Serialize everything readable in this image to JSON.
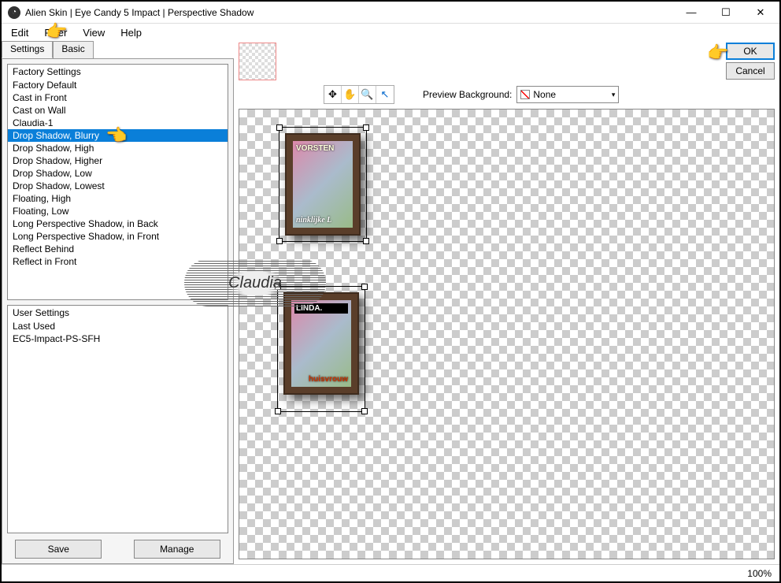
{
  "window": {
    "title": "Alien Skin | Eye Candy 5 Impact | Perspective Shadow"
  },
  "menu": {
    "items": [
      "Edit",
      "Filter",
      "View",
      "Help"
    ]
  },
  "tabs": {
    "settings": "Settings",
    "basic": "Basic"
  },
  "factory": {
    "header": "Factory Settings",
    "items": [
      "Factory Default",
      "Cast in Front",
      "Cast on Wall",
      "Claudia-1",
      "Drop Shadow, Blurry",
      "Drop Shadow, High",
      "Drop Shadow, Higher",
      "Drop Shadow, Low",
      "Drop Shadow, Lowest",
      "Floating, High",
      "Floating, Low",
      "Long Perspective Shadow, in Back",
      "Long Perspective Shadow, in Front",
      "Reflect Behind",
      "Reflect in Front"
    ],
    "selected_index": 4
  },
  "user": {
    "header": "User Settings",
    "items": [
      "Last Used",
      "EC5-Impact-PS-SFH"
    ]
  },
  "buttons": {
    "save": "Save",
    "manage": "Manage",
    "ok": "OK",
    "cancel": "Cancel"
  },
  "preview_bg": {
    "label": "Preview Background:",
    "value": "None"
  },
  "status": {
    "zoom": "100%"
  },
  "watermark": "Claudia",
  "mag1": {
    "top": "VORSTEN",
    "bottom": "ninklijke L"
  },
  "mag2": {
    "top": "LINDA.",
    "bottom": "huisvrouw"
  },
  "pointers": {
    "filter": "👉",
    "selected": "👈",
    "ok": "👉"
  }
}
